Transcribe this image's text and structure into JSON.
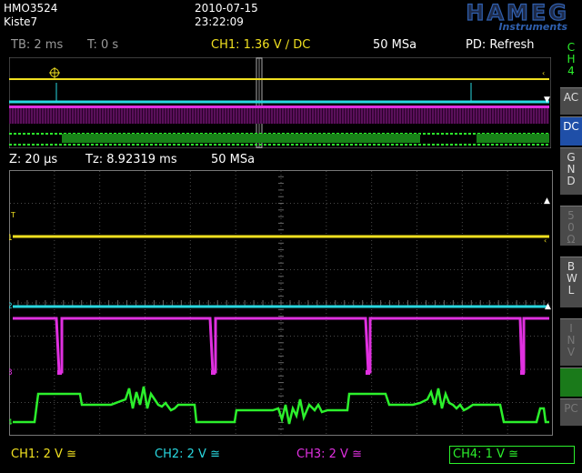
{
  "header": {
    "model": "HMO3524",
    "setup": "Kiste7",
    "date": "2010-07-15",
    "time": "23:22:09",
    "logo": "HAMEG",
    "logo_sub": "Instruments"
  },
  "status": {
    "timebase": "TB: 2 ms",
    "trigger_time": "T: 0 s",
    "trigger": "CH1: 1.36 V ∕ DC",
    "sample_rate": "50 MSa",
    "pd_mode": "PD: Refresh"
  },
  "zoom": {
    "zoom": "Z: 20 µs",
    "tz": "Tz: 8.92319 ms",
    "sample_rate": "50 MSa"
  },
  "sidebar": {
    "channel": "CH 4",
    "ac": "AC",
    "dc": "DC",
    "gnd": "GND",
    "impedance": "50 Ω",
    "bwl": "BWL",
    "inv": "INV",
    "pc": "PC"
  },
  "markers": {
    "ch1": "1",
    "ch2": "2",
    "ch3": "3",
    "ch4": "4",
    "trig": "T"
  },
  "footer": {
    "ch1": "CH1: 2 V ≅",
    "ch2": "CH2: 2 V ≅",
    "ch3": "CH3: 2 V ≅",
    "ch4": "CH4: 1 V ≅"
  },
  "colors": {
    "ch1": "#f0e020",
    "ch2": "#29d8e0",
    "ch3": "#e030e0",
    "ch4": "#2cf02c",
    "grid": "#555555",
    "active": "#1f4fa8"
  }
}
